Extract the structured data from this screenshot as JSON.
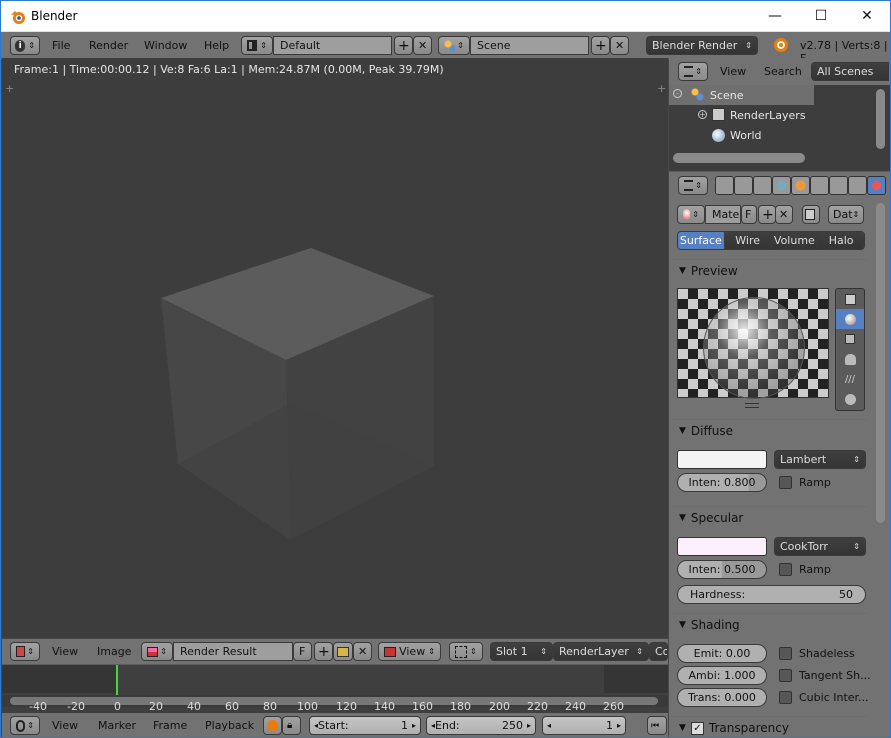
{
  "window": {
    "title": "Blender",
    "minimize": "—",
    "maximize": "☐",
    "close": "✕"
  },
  "top_header": {
    "menus": [
      "File",
      "Render",
      "Window",
      "Help"
    ],
    "layout": "Default",
    "scene": "Scene",
    "engine": "Blender Render",
    "version_info": "v2.78 | Verts:8 | F"
  },
  "viewport": {
    "info": "Frame:1 | Time:00:00.12 | Ve:8 Fa:6 La:1 | Mem:24.87M (0.00M, Peak 39.79M)"
  },
  "image_editor_header": {
    "menus": [
      "View",
      "Image"
    ],
    "image": "Render Result",
    "fake_user": "F",
    "view": "View",
    "slot": "Slot 1",
    "layer": "RenderLayer",
    "extra": "Co"
  },
  "timeline": {
    "ticks": [
      "-40",
      "-20",
      "0",
      "20",
      "40",
      "60",
      "80",
      "100",
      "120",
      "140",
      "160",
      "180",
      "200",
      "220",
      "240",
      "260"
    ],
    "menus": [
      "View",
      "Marker",
      "Frame",
      "Playback"
    ],
    "start_label": "Start:",
    "start": "1",
    "end_label": "End:",
    "end": "250",
    "current": "1"
  },
  "outliner": {
    "menus": [
      "View",
      "Search"
    ],
    "filter": "All Scenes",
    "items": [
      "Scene",
      "RenderLayers",
      "World"
    ]
  },
  "properties": {
    "material_name": "Mate",
    "fake_user": "F",
    "data": "Dat",
    "tabs": [
      "Surface",
      "Wire",
      "Volume",
      "Halo"
    ],
    "preview": {
      "title": "Preview"
    },
    "diffuse": {
      "title": "Diffuse",
      "shader": "Lambert",
      "intensity": "Inten: 0.800",
      "ramp": "Ramp"
    },
    "specular": {
      "title": "Specular",
      "shader": "CookTorr",
      "intensity": "Inten: 0.500",
      "ramp": "Ramp",
      "hardness_label": "Hardness:",
      "hardness": "50"
    },
    "shading": {
      "title": "Shading",
      "emit": "Emit:  0.00",
      "ambi": "Ambi: 1.000",
      "trans": "Trans: 0.000",
      "shadeless": "Shadeless",
      "tangent": "Tangent Sh...",
      "cubic": "Cubic Inter..."
    },
    "transparency": {
      "title": "Transparency"
    }
  },
  "colors": {
    "accent": "#5680c2",
    "frame_marker": "#4cd240",
    "diffuse_color": "#f4f4f4",
    "specular_color": "#fbf0fb"
  }
}
